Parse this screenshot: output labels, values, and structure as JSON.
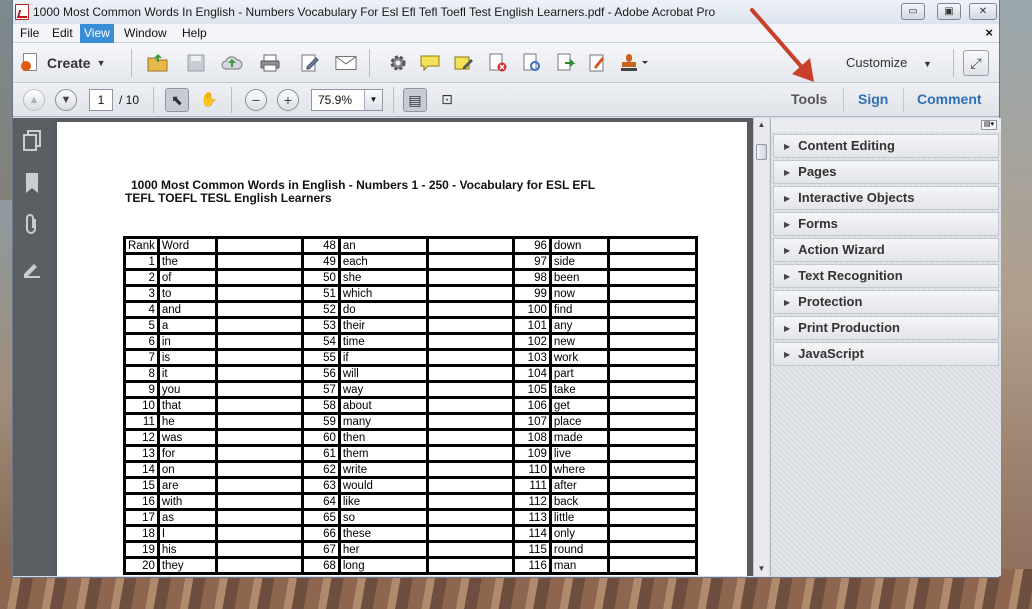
{
  "window": {
    "title": "1000 Most Common Words In English - Numbers Vocabulary For Esl Efl Tefl Toefl Test English Learners.pdf - Adobe Acrobat Pro",
    "controls": {
      "minimize": "▭",
      "restore": "▣",
      "close": "✕"
    }
  },
  "menu": {
    "items": [
      "File",
      "Edit",
      "View",
      "Window",
      "Help"
    ],
    "active": "View",
    "close": "×"
  },
  "toolbar": {
    "create_label": "Create",
    "customize_label": "Customize"
  },
  "nav": {
    "page_current": "1",
    "page_total": "/ 10",
    "zoom": "75.9%"
  },
  "panels": {
    "tools": "Tools",
    "sign": "Sign",
    "comment": "Comment"
  },
  "tools_panel": {
    "items": [
      "Content Editing",
      "Pages",
      "Interactive Objects",
      "Forms",
      "Action Wizard",
      "Text Recognition",
      "Protection",
      "Print Production",
      "JavaScript"
    ]
  },
  "document": {
    "title_line1": "1000 Most Common Words in English - Numbers 1 - 250 - Vocabulary for ESL EFL",
    "title_line2": "TEFL TOEFL TESL English Learners",
    "header": {
      "rank": "Rank",
      "word": "Word"
    },
    "rows": [
      [
        "1",
        "the",
        "49",
        "each",
        "97",
        "side"
      ],
      [
        "2",
        "of",
        "50",
        "she",
        "98",
        "been"
      ],
      [
        "3",
        "to",
        "51",
        "which",
        "99",
        "now"
      ],
      [
        "4",
        "and",
        "52",
        "do",
        "100",
        "find"
      ],
      [
        "5",
        "a",
        "53",
        "their",
        "101",
        "any"
      ],
      [
        "6",
        "in",
        "54",
        "time",
        "102",
        "new"
      ],
      [
        "7",
        "is",
        "55",
        "if",
        "103",
        "work"
      ],
      [
        "8",
        "it",
        "56",
        "will",
        "104",
        "part"
      ],
      [
        "9",
        "you",
        "57",
        "way",
        "105",
        "take"
      ],
      [
        "10",
        "that",
        "58",
        "about",
        "106",
        "get"
      ],
      [
        "11",
        "he",
        "59",
        "many",
        "107",
        "place"
      ],
      [
        "12",
        "was",
        "60",
        "then",
        "108",
        "made"
      ],
      [
        "13",
        "for",
        "61",
        "them",
        "109",
        "live"
      ],
      [
        "14",
        "on",
        "62",
        "write",
        "110",
        "where"
      ],
      [
        "15",
        "are",
        "63",
        "would",
        "111",
        "after"
      ],
      [
        "16",
        "with",
        "64",
        "like",
        "112",
        "back"
      ],
      [
        "17",
        "as",
        "65",
        "so",
        "113",
        "little"
      ],
      [
        "18",
        "I",
        "66",
        "these",
        "114",
        "only"
      ],
      [
        "19",
        "his",
        "67",
        "her",
        "115",
        "round"
      ],
      [
        "20",
        "they",
        "68",
        "long",
        "116",
        "man"
      ]
    ],
    "first_row": [
      "48",
      "an",
      "96",
      "down"
    ]
  },
  "colors": {
    "accent_blue": "#2f6fb5",
    "annotation_red": "#c9402a"
  }
}
